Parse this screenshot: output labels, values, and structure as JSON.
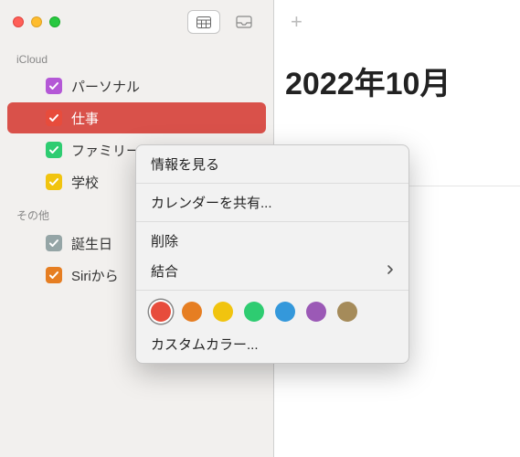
{
  "sidebar": {
    "sections": [
      {
        "title": "iCloud",
        "items": [
          {
            "label": "パーソナル",
            "color": "#b458d6",
            "selected": false
          },
          {
            "label": "仕事",
            "color": "#e74c3c",
            "selected": true
          },
          {
            "label": "ファミリー",
            "color": "#2ecc71",
            "selected": false
          },
          {
            "label": "学校",
            "color": "#f1c40f",
            "selected": false
          }
        ]
      },
      {
        "title": "その他",
        "items": [
          {
            "label": "誕生日",
            "color": "#95a5a6",
            "selected": false
          },
          {
            "label": "Siriから",
            "color": "#e67e22",
            "selected": false
          }
        ]
      }
    ]
  },
  "main": {
    "title": "2022年10月"
  },
  "context_menu": {
    "items": [
      {
        "label": "情報を見る",
        "type": "item"
      },
      {
        "type": "sep"
      },
      {
        "label": "カレンダーを共有...",
        "type": "item"
      },
      {
        "type": "sep"
      },
      {
        "label": "削除",
        "type": "item"
      },
      {
        "label": "結合",
        "type": "submenu"
      },
      {
        "type": "sep"
      },
      {
        "type": "colors"
      },
      {
        "label": "カスタムカラー...",
        "type": "item"
      }
    ],
    "colors": [
      {
        "hex": "#e74c3c",
        "selected": true
      },
      {
        "hex": "#e67e22",
        "selected": false
      },
      {
        "hex": "#f1c40f",
        "selected": false
      },
      {
        "hex": "#2ecc71",
        "selected": false
      },
      {
        "hex": "#3498db",
        "selected": false
      },
      {
        "hex": "#9b59b6",
        "selected": false
      },
      {
        "hex": "#a58b5a",
        "selected": false
      }
    ]
  }
}
